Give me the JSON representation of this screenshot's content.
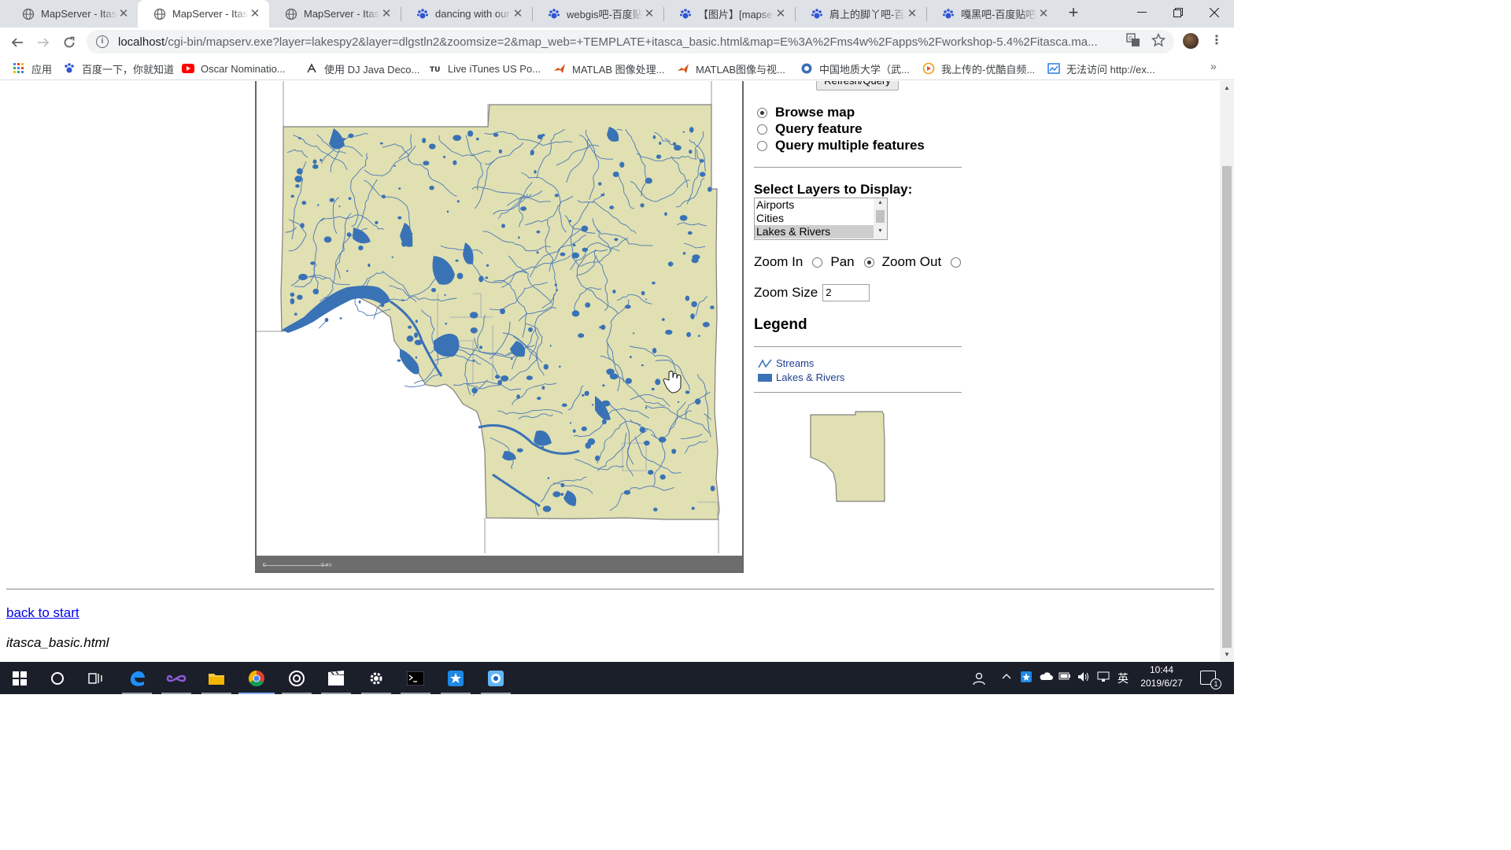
{
  "browser": {
    "tabs": [
      {
        "title": "MapServer - Itasca",
        "icon": "globe-icon",
        "active": false
      },
      {
        "title": "MapServer - Itasca",
        "icon": "globe-icon",
        "active": true
      },
      {
        "title": "MapServer - Itasca",
        "icon": "globe-icon",
        "active": false
      },
      {
        "title": "dancing with our",
        "icon": "baidu-paw-icon",
        "active": false
      },
      {
        "title": "webgis吧-百度贴吧",
        "icon": "baidu-paw-icon",
        "active": false
      },
      {
        "title": "【图片】[mapserver",
        "icon": "baidu-paw-icon",
        "active": false
      },
      {
        "title": "肩上的脚丫吧-百度",
        "icon": "baidu-paw-icon",
        "active": false
      },
      {
        "title": "嘎黑吧-百度贴吧--",
        "icon": "baidu-paw-icon",
        "active": false
      }
    ],
    "tab_close_glyph": "✕",
    "new_tab_glyph": "+",
    "url_host": "localhost",
    "url_rest": "/cgi-bin/mapserv.exe?layer=lakespy2&layer=dlgstln2&zoomsize=2&map_web=+TEMPLATE+itasca_basic.html&map=E%3A%2Fms4w%2Fapps%2Fworkshop-5.4%2Fitasca.ma...",
    "bookmarks": [
      {
        "label": "应用",
        "icon": "apps-grid-icon",
        "color": "#4285f4"
      },
      {
        "label": "百度一下，你就知道",
        "icon": "baidu-paw-icon",
        "color": "#2932e1"
      },
      {
        "label": "Oscar Nominatio...",
        "icon": "youtube-icon",
        "color": "#ff0000"
      },
      {
        "label": "使用 DJ Java Deco...",
        "icon": "dj-icon",
        "color": "#333333"
      },
      {
        "label": "Live iTunes US Po...",
        "icon": "itunes-chart-icon",
        "color": "#333333"
      },
      {
        "label": "MATLAB 图像处理...",
        "icon": "matlab-icon",
        "color": "#d95319"
      },
      {
        "label": "MATLAB图像与视...",
        "icon": "matlab-icon",
        "color": "#d95319"
      },
      {
        "label": "中国地质大学（武...",
        "icon": "cug-icon",
        "color": "#3b6fb6"
      },
      {
        "label": "我上传的-优酷自频...",
        "icon": "youku-icon",
        "color": "#f39c12"
      },
      {
        "label": "无法访问 http://ex...",
        "icon": "broken-page-icon",
        "color": "#1a73e8"
      }
    ]
  },
  "page": {
    "refresh_label": "Refresh/Query",
    "modes": [
      {
        "label": "Browse map",
        "checked": true
      },
      {
        "label": "Query feature",
        "checked": false
      },
      {
        "label": "Query multiple features",
        "checked": false
      }
    ],
    "layers_heading": "Select Layers to Display:",
    "layers": [
      {
        "label": "Airports",
        "selected": false
      },
      {
        "label": "Cities",
        "selected": false
      },
      {
        "label": "Lakes & Rivers",
        "selected": true
      }
    ],
    "zoom": {
      "zoom_in_label": "Zoom In",
      "pan_label": "Pan",
      "zoom_out_label": "Zoom Out",
      "selected": "pan"
    },
    "zoom_size_label": "Zoom Size",
    "zoom_size_value": "2",
    "legend_heading": "Legend",
    "legend": [
      {
        "label": "Streams",
        "symbol": "line",
        "color": "#3a6fb0"
      },
      {
        "label": "Lakes & Rivers",
        "symbol": "fill",
        "color": "#3a72b6"
      }
    ],
    "scalebar": {
      "left_label": "0",
      "right_label": "9 mi"
    },
    "back_link": "back to start",
    "template_name": "itasca_basic.html"
  },
  "map": {
    "land_color": "#e0e0b2",
    "water_color": "#3a72b6",
    "stream_color": "#4a78b8",
    "outline_color": "#808080"
  },
  "taskbar": {
    "items": [
      "windows-start-icon",
      "cortana-search-icon",
      "task-view-icon",
      "edge-icon",
      "infinity-app-icon",
      "file-explorer-icon",
      "chrome-icon",
      "media-player-icon",
      "video-editor-icon",
      "settings-gear-icon",
      "terminal-icon",
      "app-blue-icon",
      "network-tool-icon"
    ],
    "active_index": 6,
    "ime_label": "英",
    "time": "10:44",
    "date": "2019/6/27",
    "notification_count": "1"
  }
}
